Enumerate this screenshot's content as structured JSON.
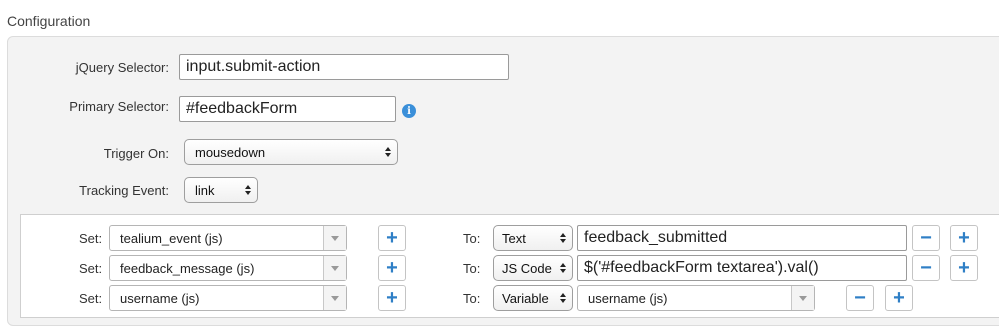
{
  "section_title": "Configuration",
  "fields": {
    "jquery_selector_label": "jQuery Selector:",
    "jquery_selector_value": "input.submit-action",
    "primary_selector_label": "Primary Selector:",
    "primary_selector_value": "#feedbackForm",
    "trigger_on_label": "Trigger On:",
    "trigger_on_value": "mousedown",
    "tracking_event_label": "Tracking Event:",
    "tracking_event_value": "link"
  },
  "mapping": {
    "set_label": "Set:",
    "to_label": "To:",
    "add_symbol": "+",
    "remove_symbol": "−",
    "rows": [
      {
        "variable": "tealium_event (js)",
        "type": "Text",
        "value": "feedback_submitted"
      },
      {
        "variable": "feedback_message (js)",
        "type": "JS Code",
        "value": "$('#feedbackForm textarea').val()"
      },
      {
        "variable": "username (js)",
        "type": "Variable",
        "value": "username (js)"
      }
    ]
  },
  "colors": {
    "accent": "#2f7fc6",
    "info": "#3a8fd9",
    "panel_bg": "#f3f3f3"
  }
}
